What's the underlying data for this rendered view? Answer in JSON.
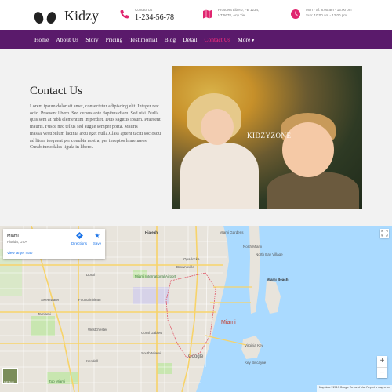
{
  "brand": {
    "name": "Kidzy"
  },
  "header": {
    "contact": {
      "label": "Contact Us",
      "phone": "1-234-56-78"
    },
    "address": {
      "line1": "Proscent Libero, FB 1234,",
      "line2": "VT 5678, Any Tie"
    },
    "hours": {
      "line1": "Mon - Sf: 8:00 am - 15:00 pm",
      "line2": "Sun: 10:00 am - 12:00 pm"
    }
  },
  "nav": {
    "items": [
      "Home",
      "About Us",
      "Story",
      "Pricing",
      "Testimonial",
      "Blog",
      "Detail",
      "Contact Us",
      "More"
    ],
    "active": "Contact Us"
  },
  "main": {
    "title": "Contact Us",
    "body": "Lorem ipsum dolor sit amet, consectetur adipiscing elit. Integer nec odio. Praesent libero. Sed cursus ante dapibus diam. Sed nisi. Nulla quis sem at nibh elementum imperdiet. Duis sagittis ipsum. Praesent mauris. Fusce nec tellus sed augue semper porta. Mauris massa.Vestibulum lacinia arcu eget nulla.Class aptent taciti sociosqu ad litora torquent per conubia nostra, per inceptos himenaeos. Curabitursodales ligula in libero.",
    "photo_watermark": "KIDZYZONE"
  },
  "map": {
    "place_name": "Miami",
    "place_sub": "Florida, USA",
    "view_larger": "View larger map",
    "directions": "Directions",
    "save": "Save",
    "attribution": "Map data ©2019 Google   Terms of Use   Report a map error",
    "google": "Google",
    "thumb_label": "Full Moon",
    "labels": {
      "hialeah": "Hialeah",
      "miami_gardens": "Miami Gardens",
      "north_miami": "North Miami",
      "north_bay": "North Bay Village",
      "miami_beach": "Miami Beach",
      "doral": "Doral",
      "miami": "Miami",
      "coral_gables": "Coral Gables",
      "key_biscayne": "Key Biscayne",
      "sweetwater": "Sweetwater",
      "westchester": "Westchester",
      "kendall": "Kendall",
      "fountainbleau": "Fountainbleau",
      "tamiami": "Tamiami",
      "brownsville": "Brownsville",
      "opa_locka": "Opa-locka",
      "virginia_key": "Virginia Key",
      "south_miami": "South Miami",
      "zoo": "Zoo Miami",
      "airport": "Miami International Airport"
    }
  }
}
